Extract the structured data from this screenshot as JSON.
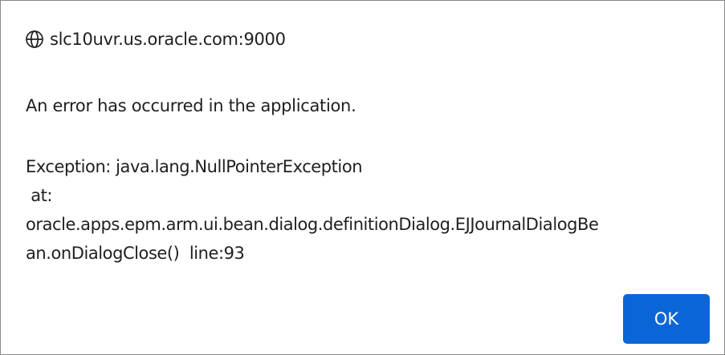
{
  "dialog": {
    "origin": "slc10uvr.us.oracle.com:9000",
    "origin_icon": "globe-icon",
    "message": "An error has occurred in the application.",
    "exception_lines": [
      "Exception: java.lang.NullPointerException",
      " at:",
      "oracle.apps.epm.arm.ui.bean.dialog.definitionDialog.EJJournalDialogBe",
      "an.onDialogClose()  line:93"
    ],
    "ok_label": "OK"
  },
  "colors": {
    "button_background": "#0a66d6",
    "button_text": "#ffffff",
    "text": "#1f1f1f",
    "border": "#8a8a8a"
  }
}
